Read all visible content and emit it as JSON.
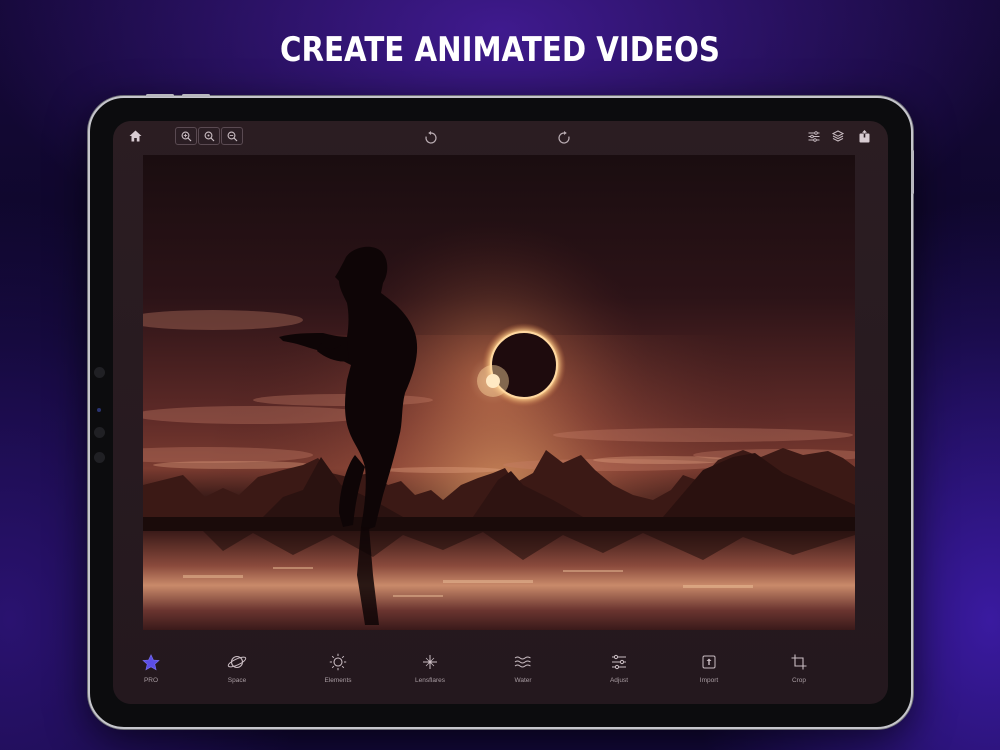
{
  "headline": "CREATE ANIMATED VIDEOS",
  "toolbar": {
    "left_icons": [
      "home-icon",
      "zoom-in-icon",
      "zoom-reset-icon",
      "zoom-out-icon"
    ],
    "center_icons": [
      "undo-icon",
      "redo-icon"
    ],
    "right_icons": [
      "sliders-icon",
      "layers-icon",
      "share-icon"
    ]
  },
  "bottom_tools": [
    {
      "label": "PRO",
      "icon": "star-icon",
      "color": "#5b4ee6"
    },
    {
      "label": "Space",
      "icon": "planet-icon"
    },
    {
      "label": "Elements",
      "icon": "sun-icon"
    },
    {
      "label": "Lensflares",
      "icon": "sparkle-icon"
    },
    {
      "label": "Water",
      "icon": "waves-icon"
    },
    {
      "label": "Adjust",
      "icon": "adjust-icon"
    },
    {
      "label": "Import",
      "icon": "import-icon"
    },
    {
      "label": "Crop",
      "icon": "crop-icon"
    }
  ],
  "colors": {
    "accent": "#5b4ee6",
    "toolbar_icon": "#c9bcc2",
    "frame": "#c6c6cc"
  }
}
